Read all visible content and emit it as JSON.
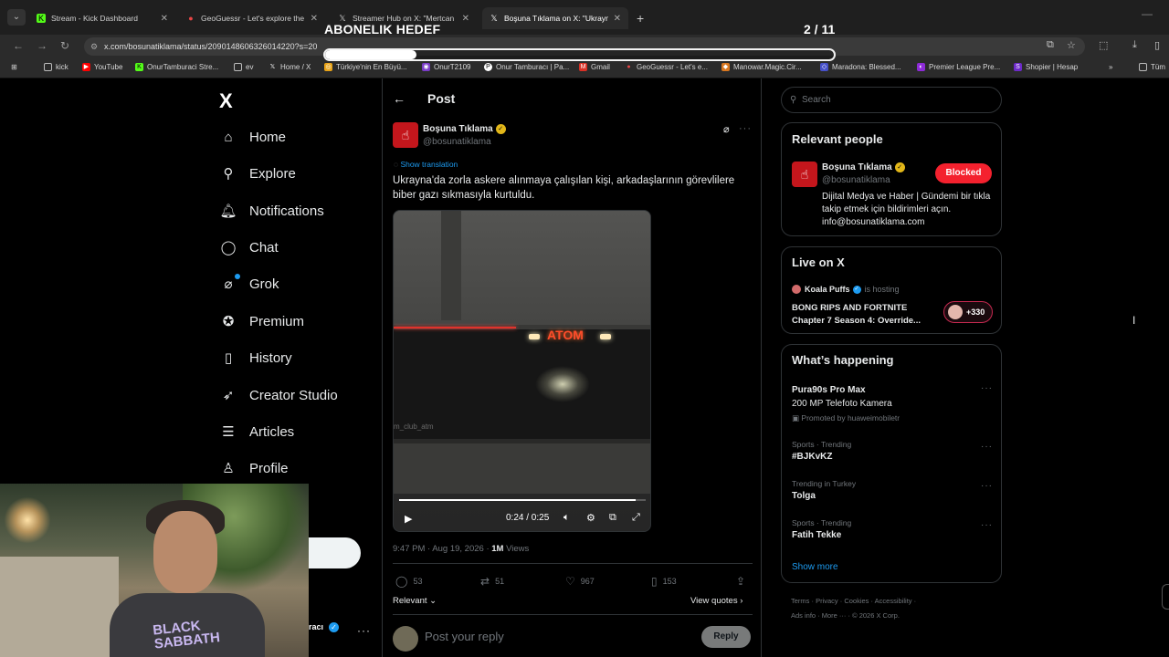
{
  "browser": {
    "tabs": [
      {
        "title": "Stream - Kick Dashboard",
        "icon": "kick-icon",
        "color": "#53fc18"
      },
      {
        "title": "GeoGuessr - Let's explore the w",
        "icon": "map-pin-icon",
        "color": "#e84545"
      },
      {
        "title": "Streamer Hub on X: \"Mertcan B",
        "icon": "x-icon",
        "color": "#ffffff"
      },
      {
        "title": "Boşuna Tıklama on X: \"Ukrayna",
        "icon": "x-icon",
        "color": "#ffffff"
      }
    ],
    "url": "x.com/bosunatiklama/status/2090148606326014220?s=20",
    "bookmarks": [
      "kick",
      "YouTube",
      "OnurTamburaci Stre...",
      "ev",
      "Home / X",
      "Türkiye'nin En Büyü...",
      "OnurT2109",
      "Onur Tamburacı | Pa...",
      "Gmail",
      "GeoGuessr - Let's e...",
      "Manowar.Magic.Cir...",
      "Maradona: Blessed...",
      "Premier League Pre...",
      "Shopier | Hesap",
      "Tüm"
    ]
  },
  "overlay": {
    "goal_label": "ABONELIK HEDEF",
    "goal_count": "2 / 11",
    "goal_progress": 0.18
  },
  "nav": {
    "logo": "X",
    "items": [
      "Home",
      "Explore",
      "Notifications",
      "Chat",
      "Grok",
      "Premium",
      "History",
      "Creator Studio",
      "Articles",
      "Profile"
    ],
    "account_fragment": "racı"
  },
  "post": {
    "header": "Post",
    "author_name": "Boşuna Tıklama",
    "author_handle": "@bosunatiklama",
    "show_translation": "Show translation",
    "text": "Ukrayna'da zorla askere alınmaya çalışılan kişi, arkadaşlarının görevlilere biber gazı sıkmasıyla kurtuldu.",
    "video": {
      "sign": "ATOM",
      "faint": "m_club_atm",
      "time": "0:24 / 0:25",
      "progress": 0.96
    },
    "timestamp": "9:47 PM · Aug 19, 2026 · ",
    "views_count": "1M",
    "views_label": " Views",
    "stats": {
      "replies": "53",
      "reposts": "51",
      "likes": "967",
      "bookmarks": "153"
    },
    "relevant": "Relevant",
    "view_quotes": "View quotes",
    "reply_placeholder": "Post your reply",
    "reply_button": "Reply"
  },
  "sidebar": {
    "search_placeholder": "Search",
    "relevant_people": {
      "title": "Relevant people",
      "name": "Boşuna Tıklama",
      "handle": "@bosunatiklama",
      "button": "Blocked",
      "bio": "Dijital Medya ve Haber | Gündemi bir tıkla takip etmek için bildirimleri açın. info@bosunatiklama.com"
    },
    "live": {
      "title": "Live on X",
      "host": "Koala Puffs",
      "hosting": "is hosting",
      "stream_title": "BONG RIPS AND FORTNITE Chapter 7 Season 4: Override...",
      "listeners": "+330"
    },
    "happening": {
      "title": "What’s happening",
      "promo": {
        "title": "Pura90s Pro Max",
        "subtitle": "200 MP Telefoto Kamera",
        "promoted": "Promoted by huaweimobiletr"
      },
      "trends": [
        {
          "context": "Sports · Trending",
          "name": "#BJKvKZ"
        },
        {
          "context": "Trending in Turkey",
          "name": "Tolga"
        },
        {
          "context": "Sports · Trending",
          "name": "Fatih Tekke"
        }
      ],
      "show_more": "Show more"
    },
    "footer": {
      "line1": "Terms  ·  Privacy  ·  Cookies  ·  Accessibility  ·",
      "line2": "Ads info  ·  More ···  ·  © 2026 X Corp."
    }
  },
  "webcam": {
    "shirt_text": "BLACK SABBATH"
  }
}
